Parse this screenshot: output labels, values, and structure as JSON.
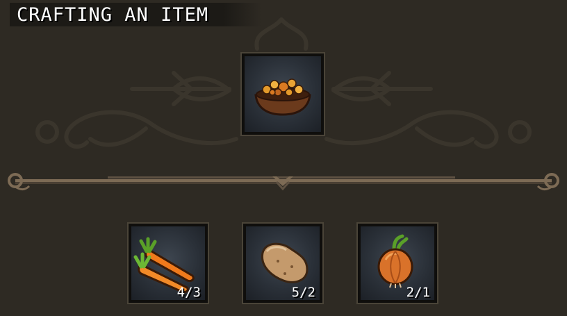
{
  "title": "CRAFTING AN ITEM",
  "result": {
    "icon": "stew-bowl-icon"
  },
  "ingredients": [
    {
      "icon": "carrot-icon",
      "count": "4/3"
    },
    {
      "icon": "potato-icon",
      "count": "5/2"
    },
    {
      "icon": "onion-icon",
      "count": "2/1"
    }
  ]
}
